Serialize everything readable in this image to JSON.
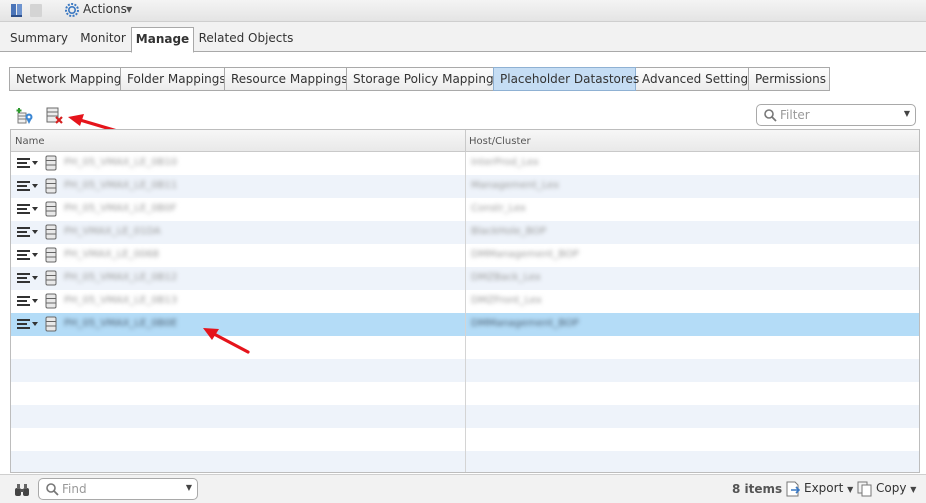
{
  "topbar": {
    "actions_label": "Actions"
  },
  "main_tabs": [
    {
      "label": "Summary",
      "active": false
    },
    {
      "label": "Monitor",
      "active": false
    },
    {
      "label": "Manage",
      "active": true
    },
    {
      "label": "Related Objects",
      "active": false
    }
  ],
  "sub_tabs": [
    {
      "label": "Network Mappings",
      "active": false
    },
    {
      "label": "Folder Mappings",
      "active": false
    },
    {
      "label": "Resource Mappings",
      "active": false
    },
    {
      "label": "Storage Policy Mappings",
      "active": false
    },
    {
      "label": "Placeholder Datastores",
      "active": true
    },
    {
      "label": "Advanced Settings",
      "active": false
    },
    {
      "label": "Permissions",
      "active": false
    }
  ],
  "toolbar": {
    "add_icon": "add-datastore-icon",
    "remove_icon": "remove-datastore-icon"
  },
  "filter": {
    "placeholder": "Filter"
  },
  "table": {
    "columns": [
      "Name",
      "Host/Cluster"
    ],
    "rows": [
      {
        "name": "PH_05_VMAX_LE_0B10",
        "host": "InterProd_Lex",
        "selected": false
      },
      {
        "name": "PH_05_VMAX_LE_0B11",
        "host": "Management_Lex",
        "selected": false
      },
      {
        "name": "PH_05_VMAX_LE_0B0F",
        "host": "Constr_Lex",
        "selected": false
      },
      {
        "name": "PH_VMAX_LE_01DA",
        "host": "BlackHole_BOP",
        "selected": false
      },
      {
        "name": "PH_VMAX_LE_0068",
        "host": "DMManagement_BOP",
        "selected": false
      },
      {
        "name": "PH_05_VMAX_LE_0B12",
        "host": "DMZBack_Lex",
        "selected": false
      },
      {
        "name": "PH_05_VMAX_LE_0B13",
        "host": "DMZFront_Lex",
        "selected": false
      },
      {
        "name": "PH_05_VMAX_LE_0B0E",
        "host": "DMManagement_BOP",
        "selected": true
      }
    ],
    "empty_row_count": 6
  },
  "footer": {
    "find_placeholder": "Find",
    "items_count": "8 items",
    "export_label": "Export",
    "copy_label": "Copy"
  },
  "colors": {
    "selected_row": "#b4dcf7",
    "active_subtab": "#c5ddf4",
    "annotation_arrow": "#e5141b"
  }
}
